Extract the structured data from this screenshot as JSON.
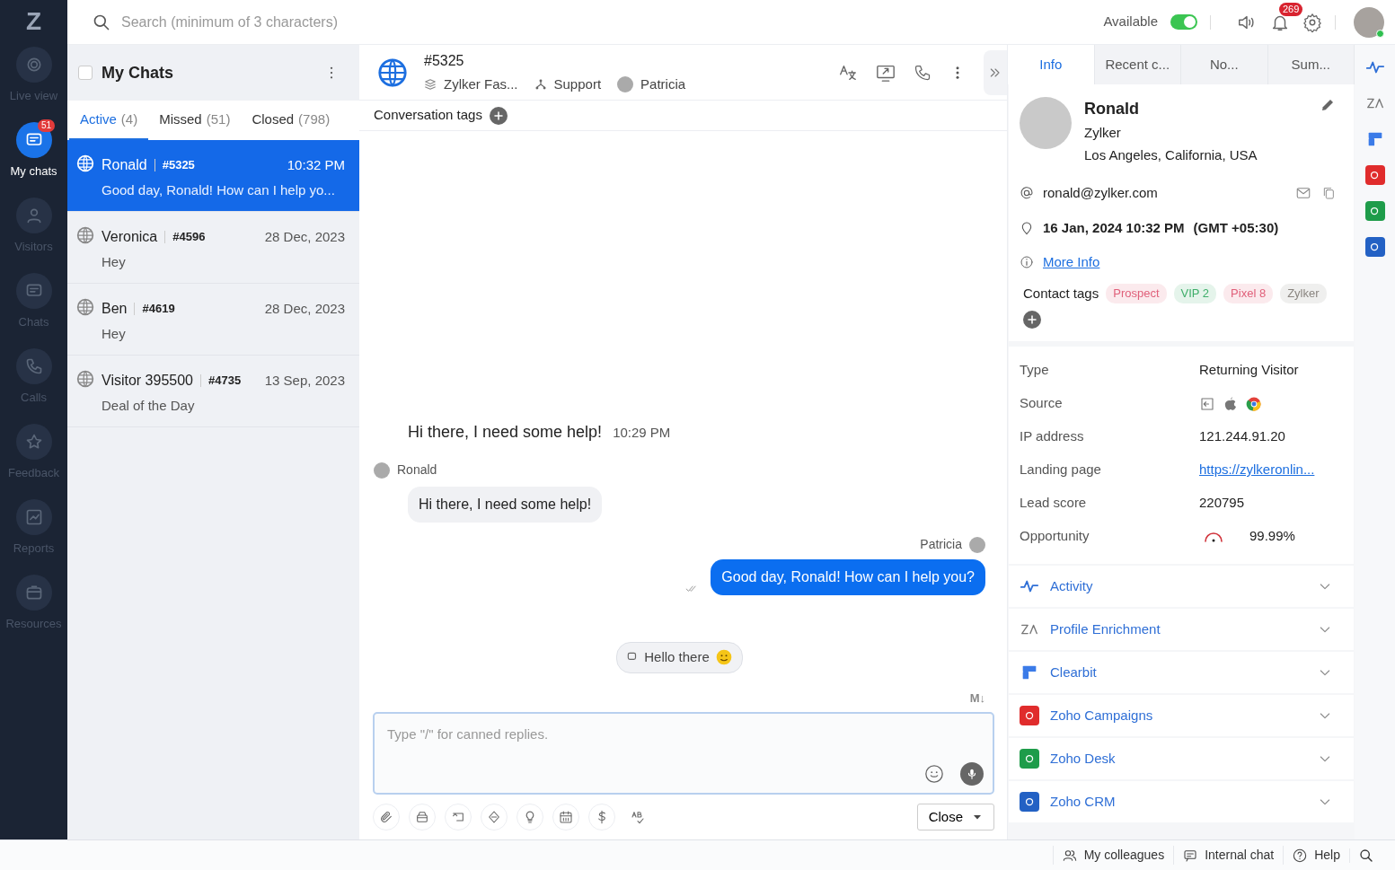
{
  "app": {
    "logo": "Z"
  },
  "nav": [
    {
      "label": "Live view",
      "selected": false
    },
    {
      "label": "My chats",
      "selected": true,
      "badge": "51"
    },
    {
      "label": "Visitors",
      "selected": false
    },
    {
      "label": "Chats",
      "selected": false
    },
    {
      "label": "Calls",
      "selected": false
    },
    {
      "label": "Feedback",
      "selected": false
    },
    {
      "label": "Reports",
      "selected": false
    },
    {
      "label": "Resources",
      "selected": false
    }
  ],
  "topbar": {
    "search": {
      "placeholder": "Search (minimum of 3 characters)"
    },
    "status_label": "Available",
    "available": true,
    "notification_count": "269"
  },
  "chat_list": {
    "select_all": false,
    "title": "My Chats",
    "tabs": [
      {
        "label": "Active",
        "count": "(4)",
        "selected": true
      },
      {
        "label": "Missed",
        "count": "(51)",
        "selected": false
      },
      {
        "label": "Closed",
        "count": "(798)",
        "selected": false
      }
    ],
    "chats": [
      {
        "name": "Ronald",
        "id": "#5325",
        "time": "10:32 PM",
        "preview": "Good day, Ronald! How can I help yo...",
        "selected": true
      },
      {
        "name": "Veronica",
        "id": "#4596",
        "time": "28 Dec, 2023",
        "preview": "Hey",
        "selected": false
      },
      {
        "name": "Ben",
        "id": "#4619",
        "time": "28 Dec, 2023",
        "preview": "Hey",
        "selected": false
      },
      {
        "name": "Visitor 395500",
        "id": "#4735",
        "time": "13 Sep, 2023",
        "preview": "Deal of the Day",
        "selected": false
      }
    ]
  },
  "conversation": {
    "id": "#5325",
    "brand": "Zylker Fas...",
    "department": "Support",
    "agent": "Patricia",
    "tags_label": "Conversation tags",
    "messages": [
      {
        "kind": "question",
        "text": "Hi there, I need some help!",
        "time": "10:29 PM"
      },
      {
        "kind": "incoming",
        "sender": "Ronald",
        "text": "Hi there, I need some help!"
      },
      {
        "kind": "outgoing",
        "sender": "Patricia",
        "text": "Good day, Ronald! How can I help you?"
      },
      {
        "kind": "suggestion",
        "text": "Hello there"
      }
    ],
    "markdown_label": "M↓",
    "composer": {
      "placeholder": "Type \"/\" for canned replies."
    },
    "close_label": "Close"
  },
  "info_panel": {
    "tabs": [
      {
        "label": "Info",
        "selected": true
      },
      {
        "label": "Recent c...",
        "selected": false
      },
      {
        "label": "No...",
        "selected": false
      },
      {
        "label": "Sum...",
        "selected": false
      }
    ],
    "contact": {
      "name": "Ronald",
      "company": "Zylker",
      "location": "Los Angeles, California, USA",
      "email": "ronald@zylker.com",
      "datetime": "16 Jan, 2024 10:32 PM",
      "timezone": "(GMT +05:30)",
      "more_info": "More Info"
    },
    "tags_label": "Contact tags",
    "tags": [
      {
        "label": "Prospect",
        "color": "#e0607a"
      },
      {
        "label": "VIP 2",
        "color": "#3fae6a"
      },
      {
        "label": "Pixel 8",
        "color": "#e0607a"
      },
      {
        "label": "Zylker",
        "color": "#8a8580"
      }
    ],
    "details": [
      {
        "label": "Type",
        "kind": "text",
        "value": "Returning Visitor"
      },
      {
        "label": "Source",
        "kind": "icons"
      },
      {
        "label": "IP address",
        "kind": "text",
        "value": "121.244.91.20"
      },
      {
        "label": "Landing page",
        "kind": "link",
        "value": "https://zylkeronlin..."
      },
      {
        "label": "Lead score",
        "kind": "text",
        "value": "220795"
      },
      {
        "label": "Opportunity",
        "kind": "gauge",
        "value": "99.99%"
      }
    ],
    "sections": [
      {
        "label": "Activity",
        "kind": "pulse",
        "color": "#2f6fd6"
      },
      {
        "label": "Profile Enrichment",
        "kind": "mark",
        "color": "#777777"
      },
      {
        "label": "Clearbit",
        "kind": "flag",
        "color": "#3b7be8"
      },
      {
        "label": "Zoho Campaigns",
        "kind": "tile",
        "color": "#e02c2c"
      },
      {
        "label": "Zoho Desk",
        "kind": "tile",
        "color": "#1e9c4a"
      },
      {
        "label": "Zoho CRM",
        "kind": "tile",
        "color": "#2361c4"
      }
    ]
  },
  "bottom_bar": [
    {
      "label": "My colleagues"
    },
    {
      "label": "Internal chat"
    },
    {
      "label": "Help"
    }
  ]
}
